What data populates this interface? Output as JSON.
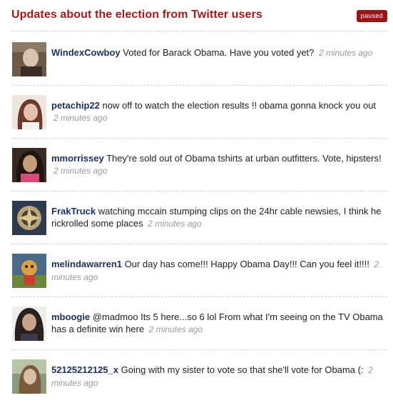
{
  "header": {
    "title": "Updates about the election from Twitter users",
    "status_badge": "paused"
  },
  "tweets": [
    {
      "username": "WindexCowboy",
      "text": "Voted for Barack Obama. Have you voted yet?",
      "time": "2 minutes ago",
      "avatar_colors": {
        "bg": "#6b5a4a",
        "fg": "#d8c4ae"
      }
    },
    {
      "username": "petachip22",
      "text": "now off to watch the election results !! obama gonna knock you out",
      "time": "2 minutes ago",
      "avatar_colors": {
        "bg": "#d7bfb0",
        "fg": "#6a3a2a"
      }
    },
    {
      "username": "mmorrissey",
      "text": "They're sold out of Obama tshirts at urban outfitters. Vote, hipsters!",
      "time": "2 minutes ago",
      "avatar_colors": {
        "bg": "#3a2a22",
        "fg": "#c79a78"
      }
    },
    {
      "username": "FrakTruck",
      "text": "watching mccain stumping clips on the 24hr cable newsies, I think he rickrolled some places",
      "time": "2 minutes ago",
      "avatar_colors": {
        "bg": "#2e3b4e",
        "fg": "#b8a47a"
      }
    },
    {
      "username": "melindawarren1",
      "text": "Our day has come!!! Happy Obama Day!!! Can you feel it!!!!",
      "time": "2 minutes ago",
      "avatar_colors": {
        "bg": "#4a6a8a",
        "fg": "#e0a040"
      }
    },
    {
      "username": "mboogie",
      "text": "@madmoo Its 5 here...so 6 lol From what I'm seeing on the TV Obama has a definite win here",
      "time": "2 minutes ago",
      "avatar_colors": {
        "bg": "#2a2020",
        "fg": "#c9a28a"
      }
    },
    {
      "username": "52125212125_x",
      "text": "Going with my sister to vote so that she'll vote for Obama (:",
      "time": "2 minutes ago",
      "avatar_colors": {
        "bg": "#8a9a7a",
        "fg": "#d8c0a8"
      }
    }
  ]
}
